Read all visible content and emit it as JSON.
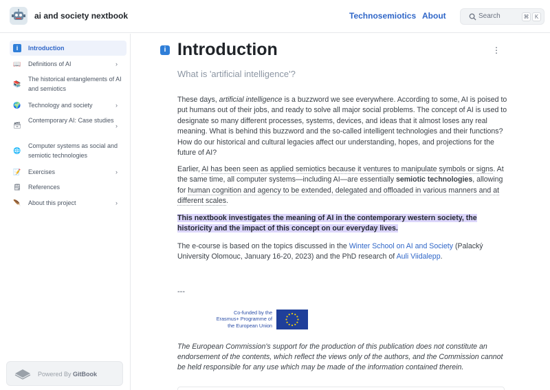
{
  "header": {
    "site_title": "ai and society nextbook",
    "nav": [
      "Technosemiotics",
      "About"
    ],
    "search": {
      "placeholder": "Search",
      "shortcut_keys": [
        "⌘",
        "K"
      ]
    },
    "accent_color": "#2f66c8"
  },
  "sidebar": {
    "items": [
      {
        "label": "Introduction",
        "icon": "info-icon",
        "active": true,
        "expandable": false
      },
      {
        "label": "Definitions of AI",
        "icon": "book-icon",
        "active": false,
        "expandable": true
      },
      {
        "label": "The historical entanglements of AI and semiotics",
        "icon": "books-icon",
        "active": false,
        "expandable": false
      },
      {
        "label": "Technology and society",
        "icon": "globe-icon",
        "active": false,
        "expandable": true
      },
      {
        "label": "Contemporary AI: Case studies",
        "icon": "card-box-icon",
        "active": false,
        "expandable": true
      },
      {
        "label": "Computer systems as social and semiotic technologies",
        "icon": "network-globe-icon",
        "active": false,
        "expandable": false
      },
      {
        "label": "Exercises",
        "icon": "pencil-icon",
        "active": false,
        "expandable": true
      },
      {
        "label": "References",
        "icon": "notepad-icon",
        "active": false,
        "expandable": false
      },
      {
        "label": "About this project",
        "icon": "feather-icon",
        "active": false,
        "expandable": true
      }
    ],
    "powered_by": {
      "prefix": "Powered By",
      "brand": "GitBook"
    }
  },
  "main": {
    "title": "Introduction",
    "subtitle": "What is 'artificial intelligence'?",
    "para1": {
      "before": "These days, ",
      "em": "artificial intelligence",
      "after": " is a buzzword we see everywhere. According to some, AI is poised to put humans out of their jobs, and ready to solve all major social problems. The concept of AI is used to designate so many different processes, systems, devices, and ideas that it almost loses any real meaning. What is behind this buzzword and the so-called intelligent technologies and their functions? How do our historical and cultural legacies affect our understanding, hopes, and projections for the future of AI?"
    },
    "para2": {
      "lead": "Earlier, ",
      "underlined1": "AI has been seen as applied semiotics because it ventures to manipulate symbols or signs",
      "mid": ". At the same time, all computer systems—including AI—are essentially ",
      "bold": "semiotic technologies",
      "mid2": ", allowing for ",
      "underlined2": "human cognition and agency to be extended, delegated and offloaded in various manners and at different scales",
      "end": "."
    },
    "para3_highlight": "This nextbook investigates the meaning of AI in the contemporary western society, the historicity and the impact of this concept on our everyday lives.",
    "para4": {
      "before": "The e-course is based on the topics discussed in the ",
      "link1": "Winter School on AI and Society",
      "middle": " (Palacký University Olomouc, January 16-20, 2023) and the PhD research of ",
      "link2": "Auli Viidalepp",
      "end": "."
    },
    "separator": "---",
    "eu_logo_text": "Co-funded by the Erasmus+ Programme of the European Union",
    "disclaimer": "The European Commission's support for the production of this publication does not constitute an endorsement of the contents, which reflect the views only of the authors, and the Commission cannot be held responsible for any use which may be made of the information contained therein."
  }
}
